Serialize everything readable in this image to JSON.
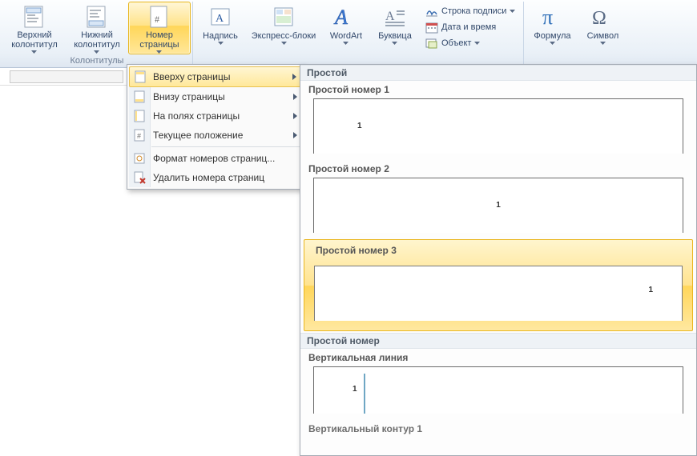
{
  "ribbon": {
    "group_headers_footers": "Колонтитулы",
    "header_btn": "Верхний\nколонтитул",
    "footer_btn": "Нижний\nколонтитул",
    "pagenum_btn": "Номер\nстраницы",
    "textbox_btn": "Надпись",
    "quickparts_btn": "Экспресс-блоки",
    "wordart_btn": "WordArt",
    "dropcap_btn": "Буквица",
    "signature_line": "Строка подписи",
    "date_time": "Дата и время",
    "object_btn": "Объект",
    "equation_btn": "Формула",
    "symbol_btn": "Символ"
  },
  "dropdown": {
    "top_of_page": "Вверху страницы",
    "bottom_of_page": "Внизу страницы",
    "page_margins": "На полях страницы",
    "current_position": "Текущее положение",
    "format_numbers": "Формат номеров страниц...",
    "remove_numbers": "Удалить номера страниц"
  },
  "gallery": {
    "section_simple": "Простой",
    "item1": "Простой номер 1",
    "item2": "Простой номер 2",
    "item3": "Простой номер 3",
    "section_plain": "Простой номер",
    "item_vline": "Вертикальная линия",
    "item_vcontour": "Вертикальный контур 1",
    "num": "1"
  }
}
